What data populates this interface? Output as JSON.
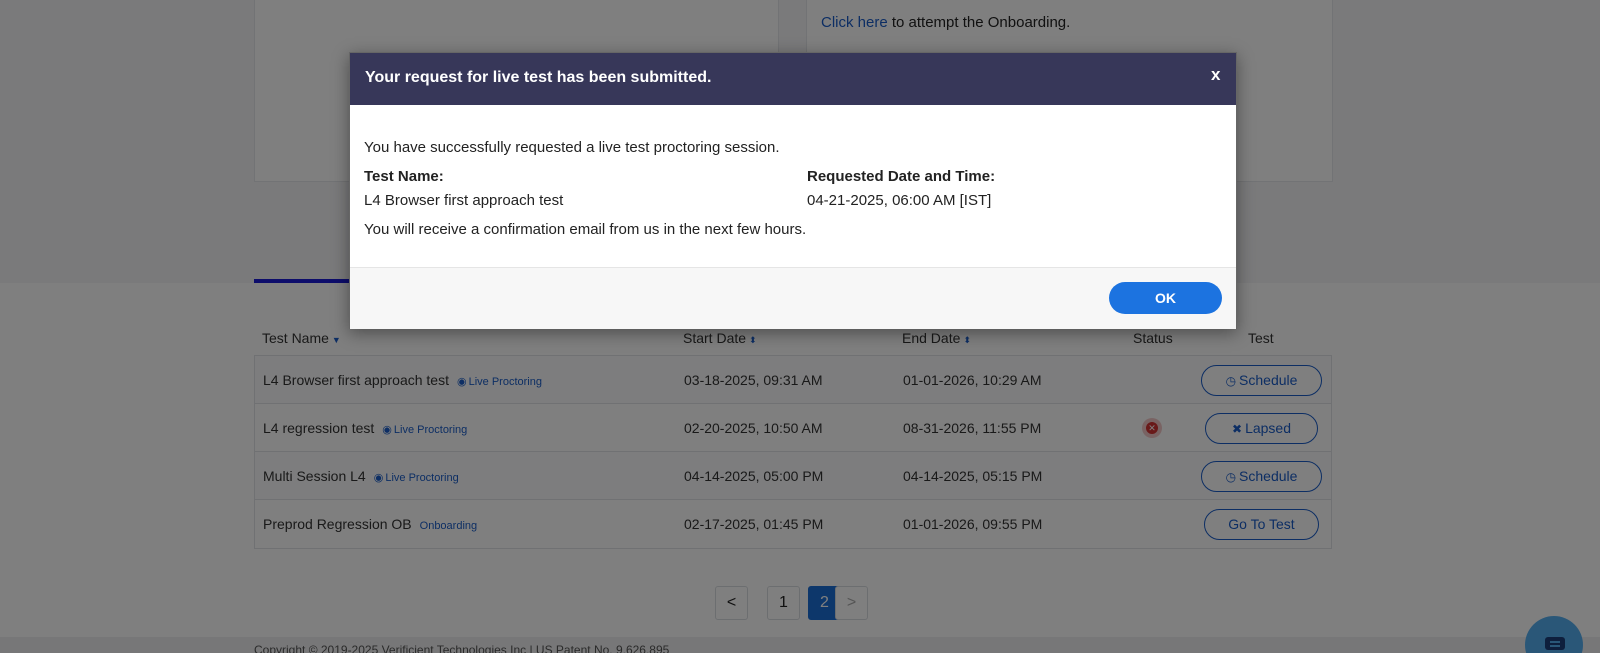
{
  "background": {
    "onboarding": {
      "link_text": "Click here",
      "rest_text": " to attempt the Onboarding."
    },
    "table": {
      "headers": {
        "test_name": "Test Name",
        "start_date": "Start Date",
        "end_date": "End Date",
        "status": "Status",
        "test": "Test"
      },
      "rows": [
        {
          "name": "L4 Browser first approach test",
          "tag": "Live Proctoring",
          "start": "03-18-2025, 09:31 AM",
          "end": "01-01-2026, 10:29 AM",
          "action": "Schedule"
        },
        {
          "name": "L4 regression test",
          "tag": "Live Proctoring",
          "start": "02-20-2025, 10:50 AM",
          "end": "08-31-2026, 11:55 PM",
          "action": "Lapsed"
        },
        {
          "name": "Multi Session L4",
          "tag": "Live Proctoring",
          "start": "04-14-2025, 05:00 PM",
          "end": "04-14-2025, 05:15 PM",
          "action": "Schedule"
        },
        {
          "name": "Preprod Regression OB",
          "tag": "Onboarding",
          "start": "02-17-2025, 01:45 PM",
          "end": "01-01-2026, 09:55 PM",
          "action": "Go To Test"
        }
      ]
    },
    "pagination": {
      "prev": "<",
      "pages": [
        "1",
        "2"
      ],
      "current": "2",
      "next": ">"
    },
    "footer": {
      "text": "Copyright © 2019-2025 Verificient Technologies Inc | US Patent No. 9,626,895"
    }
  },
  "modal": {
    "title": "Your request for live test has been submitted.",
    "close_label": "x",
    "intro": "You have successfully requested a live test proctoring session.",
    "test_name_label": "Test Name:",
    "test_name_value": "L4 Browser first approach test",
    "datetime_label": "Requested Date and Time:",
    "datetime_value": "04-21-2025, 06:00 AM [IST]",
    "confirmation": "You will receive a confirmation email from us in the next few hours.",
    "ok_label": "OK"
  },
  "colors": {
    "modal_header": "#373759",
    "primary": "#1c73e0",
    "link": "#1a5dc8",
    "overlay": "rgba(0,0,0,0.5)"
  }
}
